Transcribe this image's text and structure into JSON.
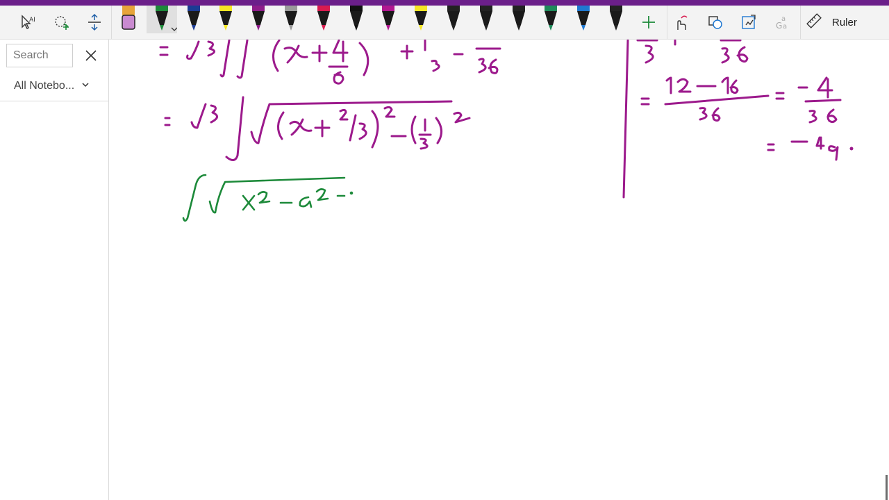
{
  "toolbar": {
    "tools": [
      {
        "name": "type-select-icon"
      },
      {
        "name": "lasso-select-icon"
      },
      {
        "name": "insert-space-icon"
      }
    ],
    "pens": [
      {
        "name": "eraser-pen",
        "color": "#e7a43a"
      },
      {
        "name": "green-pen",
        "color": "#1d8a3a",
        "selected": true
      },
      {
        "name": "navy-pen",
        "color": "#1c3c94"
      },
      {
        "name": "yellow-highlighter",
        "color": "#f5e623"
      },
      {
        "name": "purple-pen",
        "color": "#8e1d8a"
      },
      {
        "name": "galaxy-pen",
        "color": "#9a9a9a"
      },
      {
        "name": "red-pen",
        "color": "#d81b4f"
      },
      {
        "name": "black-pen",
        "color": "#111111"
      },
      {
        "name": "magenta-pen",
        "color": "#b01890"
      },
      {
        "name": "yellow-highlighter-2",
        "color": "#f5e623"
      },
      {
        "name": "black-pen-2",
        "color": "#222222"
      },
      {
        "name": "black-pen-3",
        "color": "#222222"
      },
      {
        "name": "black-pen-4",
        "color": "#222222"
      },
      {
        "name": "teal-pen",
        "color": "#1e8a5a"
      },
      {
        "name": "blue-pen",
        "color": "#1f78d1"
      },
      {
        "name": "black-pen-5",
        "color": "#222222"
      }
    ],
    "add_pen_icon": "plus-icon",
    "ink_to_shape_icon": "touch-writing-icon",
    "shapes_icon": "shapes-icon",
    "replay_icon": "ink-replay-icon",
    "math_icon": "math-icon",
    "ruler_label": "Ruler"
  },
  "left_panel": {
    "search_placeholder": "Search",
    "notebook_dropdown_label": "All Notebo..."
  },
  "colors": {
    "accent": "#6b1f8a",
    "ink_magenta": "#9c1a8c",
    "ink_green": "#1d8a3a"
  }
}
